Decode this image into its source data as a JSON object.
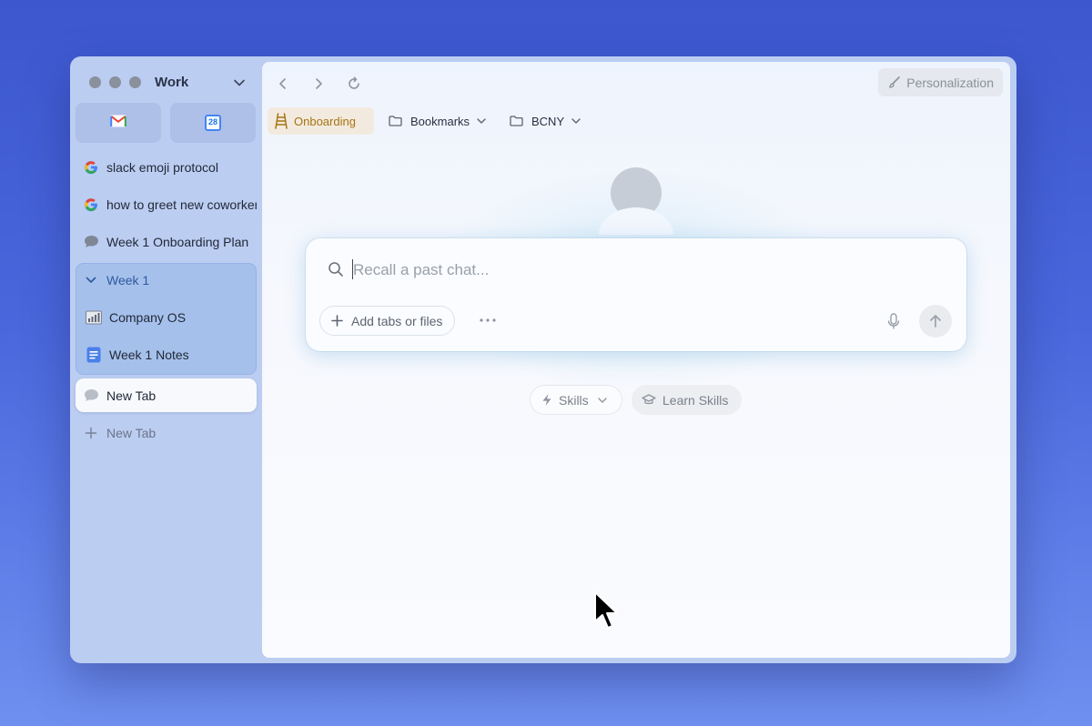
{
  "colors": {
    "accent": "#4a67dc",
    "onboarding": "#a67512",
    "folder_highlight": "#a6c0ec"
  },
  "sidebar": {
    "space_name": "Work",
    "pinned": [
      {
        "icon": "gmail-icon"
      },
      {
        "icon": "calendar-icon",
        "day": "28"
      }
    ],
    "tabs": [
      {
        "label": "slack emoji protocol",
        "icon": "google-icon"
      },
      {
        "label": "how to greet new coworkers",
        "icon": "google-icon"
      },
      {
        "label": "Week 1 Onboarding Plan",
        "icon": "chat-bubble-icon"
      }
    ],
    "folder": {
      "name": "Week 1",
      "items": [
        {
          "label": "Company OS",
          "icon": "chart-icon"
        },
        {
          "label": "Week 1 Notes",
          "icon": "doc-icon"
        }
      ]
    },
    "active_tab": {
      "label": "New Tab",
      "icon": "chat-bubble-icon"
    },
    "new_tab_label": "New Tab"
  },
  "toolbar": {
    "personalization_label": "Personalization"
  },
  "bookmarks": [
    {
      "label": "Onboarding",
      "icon": "ladder-icon"
    },
    {
      "label": "Bookmarks",
      "icon": "folder-icon"
    },
    {
      "label": "BCNY",
      "icon": "folder-icon"
    }
  ],
  "main": {
    "search_placeholder": "Recall a past chat...",
    "add_label": "Add tabs or files",
    "skills_label": "Skills",
    "learn_label": "Learn Skills"
  }
}
